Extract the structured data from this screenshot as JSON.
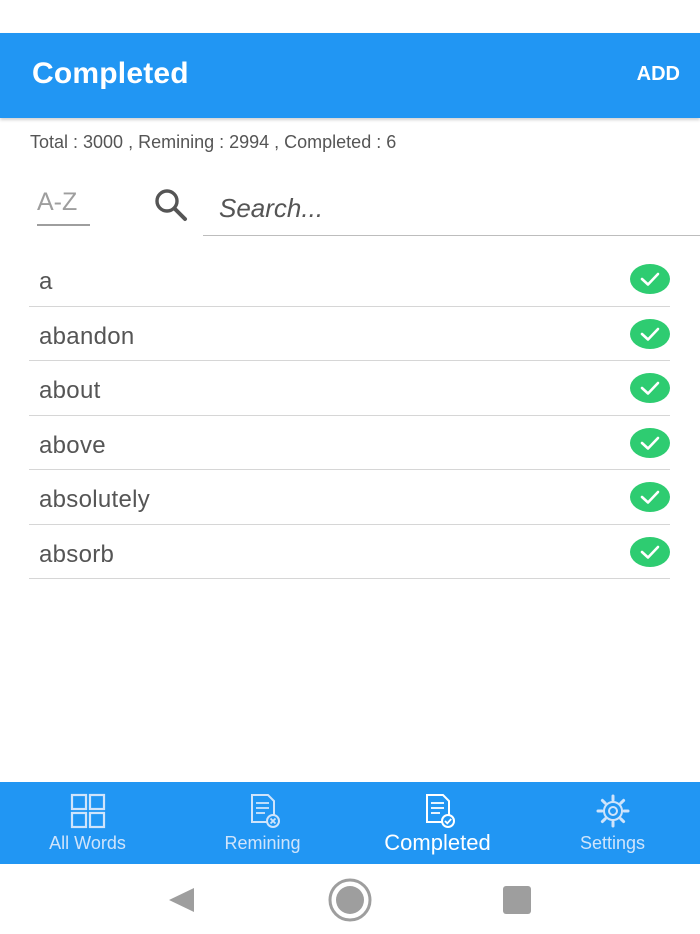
{
  "app_bar": {
    "title": "Completed",
    "action_label": "ADD"
  },
  "stats": {
    "text": "Total : 3000 , Remining : 2994 , Completed : 6"
  },
  "toolbar": {
    "sort_label": "A-Z",
    "search_placeholder": "Search..."
  },
  "words": [
    {
      "word": "a",
      "status": "completed"
    },
    {
      "word": "abandon",
      "status": "completed"
    },
    {
      "word": "about",
      "status": "completed"
    },
    {
      "word": "above",
      "status": "completed"
    },
    {
      "word": "absolutely",
      "status": "completed"
    },
    {
      "word": "absorb",
      "status": "completed"
    }
  ],
  "bottom_nav": {
    "items": [
      {
        "label": "All Words",
        "icon": "grid-icon",
        "active": false
      },
      {
        "label": "Remining",
        "icon": "document-remove-icon",
        "active": false
      },
      {
        "label": "Completed",
        "icon": "document-check-icon",
        "active": true
      },
      {
        "label": "Settings",
        "icon": "gear-icon",
        "active": false
      }
    ]
  },
  "colors": {
    "primary": "#2196f3",
    "check": "#2ecc71",
    "text": "#555555"
  }
}
